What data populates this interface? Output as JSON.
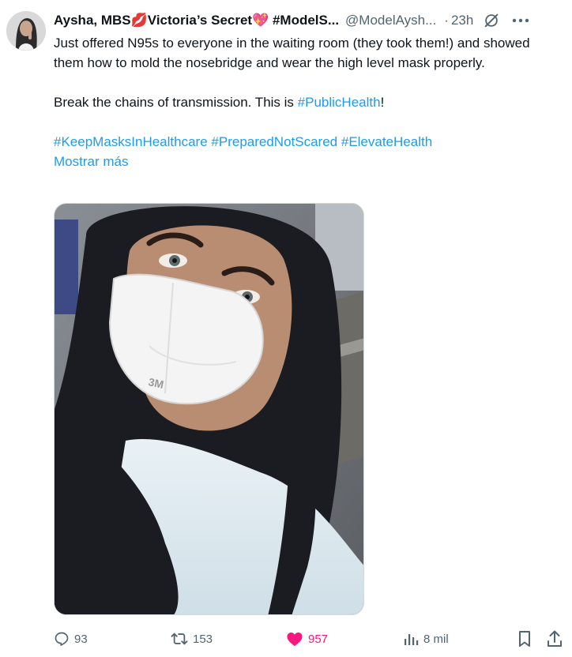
{
  "tweet": {
    "display_name": "Aysha, MBS💋Victoria’s Secret💖 #ModelS...",
    "handle": "@ModelAysh...",
    "dot": "·",
    "time": "23h",
    "body": {
      "line1": "Just offered N95s to everyone in the waiting room (they took them!) and showed them how to mold the nosebridge and wear the high level mask properly.",
      "line2_prefix": "Break the chains of transmission. This is ",
      "line2_hashtag": "#PublicHealth",
      "line2_suffix": "!",
      "hashtags": [
        "#KeepMasksInHealthcare",
        "#PreparedNotScared",
        "#ElevateHealth"
      ],
      "show_more": "Mostrar más"
    }
  },
  "actions": {
    "reply_count": "93",
    "retweet_count": "153",
    "like_count": "957",
    "views_count": "8 mil"
  },
  "icons": {
    "avatar": "user-avatar",
    "grok": "grok-icon",
    "more": "more-icon",
    "reply": "reply-icon",
    "retweet": "retweet-icon",
    "like": "heart-icon",
    "views": "views-icon",
    "bookmark": "bookmark-icon",
    "share": "share-icon"
  },
  "colors": {
    "link": "#1d9bf0",
    "like_active": "#f91880",
    "muted": "#536471",
    "text": "#0f1419"
  }
}
